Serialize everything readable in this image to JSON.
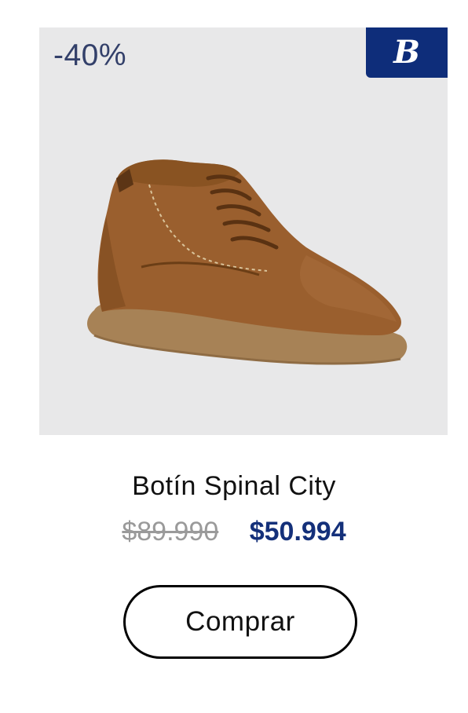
{
  "product": {
    "discount_badge": "-40%",
    "brand_logo_text": "B",
    "title": "Botín Spinal City",
    "old_price": "$89.990",
    "new_price": "$50.994",
    "buy_label": "Comprar",
    "image_icon": "shoe-image"
  },
  "colors": {
    "brand": "#0e2d7a",
    "new_price": "#14307a",
    "old_price": "#9a9a9a",
    "image_background": "#e8e8e9"
  }
}
